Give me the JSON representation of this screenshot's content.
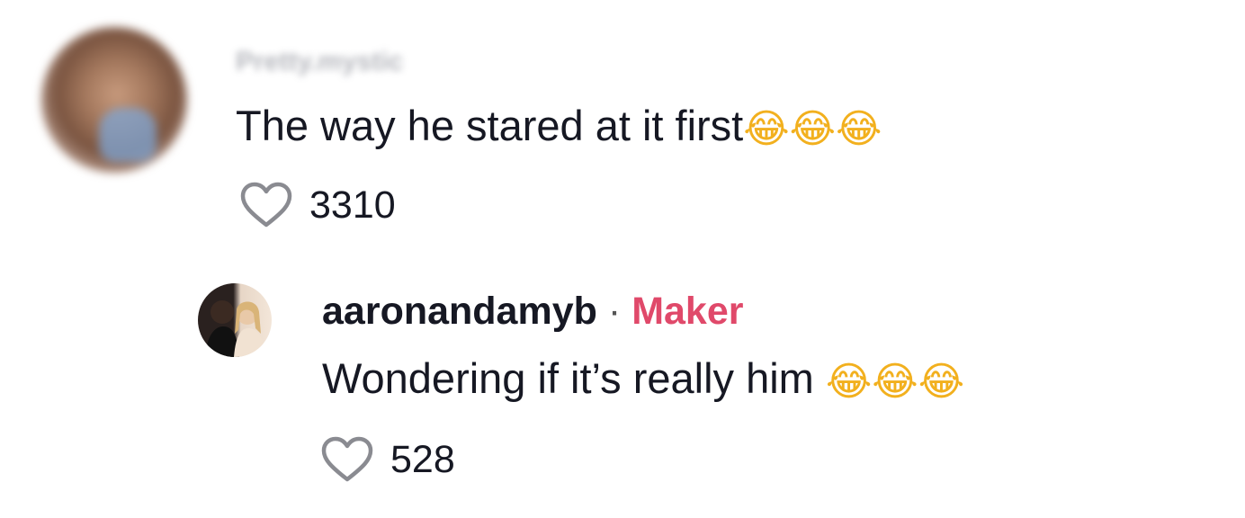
{
  "comments": [
    {
      "username": "Pretty.mystic",
      "text": "The way he stared at it first",
      "emoji": "😂😂😂",
      "likes": "3310"
    }
  ],
  "reply": {
    "username": "aaronandamyb",
    "separator": "·",
    "badge": "Maker",
    "text": "Wondering if it’s really him ",
    "emoji": "😂😂😂",
    "likes": "528"
  },
  "colors": {
    "text": "#161823",
    "maker_badge": "#e0496a",
    "heart_outline": "#8a8b91"
  },
  "icons": {
    "like": "heart-outline-icon",
    "emoji": "face-with-tears-of-joy"
  }
}
